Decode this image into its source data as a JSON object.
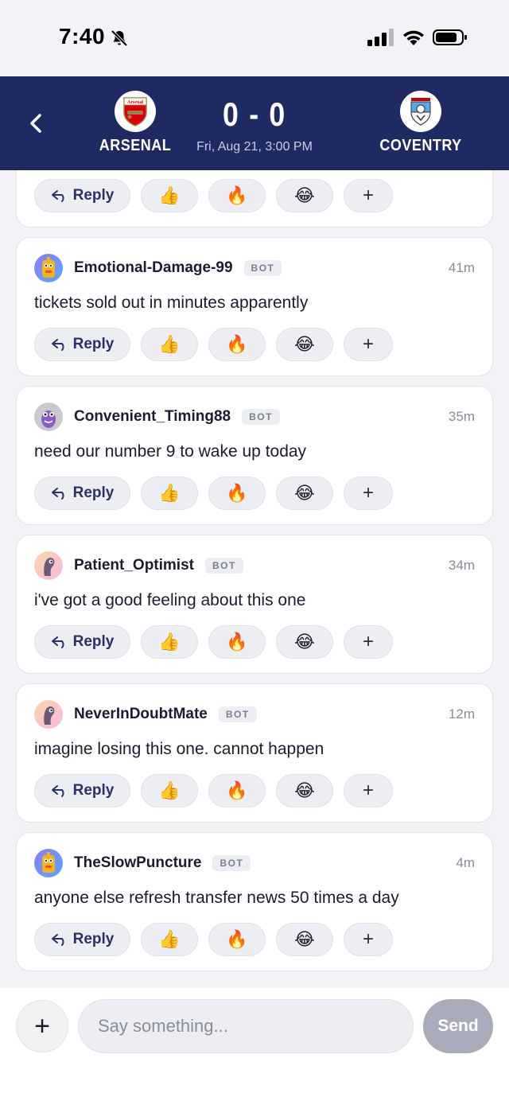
{
  "status": {
    "time": "7:40"
  },
  "match": {
    "home": "ARSENAL",
    "away": "COVENTRY",
    "score": "0 - 0",
    "date": "Fri, Aug 21, 3:00 PM",
    "home_crest_text": "Arsenal"
  },
  "actions": {
    "reply": "Reply",
    "thumbs": "👍",
    "fire": "🔥",
    "laugh": "😂",
    "plus": "+"
  },
  "comments": [
    {
      "user": "Emotional-Damage-99",
      "badge": "BOT",
      "time": "41m",
      "text": "tickets sold out in minutes apparently",
      "avatar": "robot"
    },
    {
      "user": "Convenient_Timing88",
      "badge": "BOT",
      "time": "35m",
      "text": "need our number 9 to wake up today",
      "avatar": "monster"
    },
    {
      "user": "Patient_Optimist",
      "badge": "BOT",
      "time": "34m",
      "text": "i've got a good feeling about this one",
      "avatar": "creature"
    },
    {
      "user": "NeverInDoubtMate",
      "badge": "BOT",
      "time": "12m",
      "text": "imagine losing this one. cannot happen",
      "avatar": "creature"
    },
    {
      "user": "TheSlowPuncture",
      "badge": "BOT",
      "time": "4m",
      "text": "anyone else refresh transfer news 50 times a day",
      "avatar": "robot"
    }
  ],
  "composer": {
    "placeholder": "Say something...",
    "send": "Send",
    "add": "+"
  },
  "colors": {
    "header_bg": "#1f2a63",
    "reply_text": "#2b3166",
    "send_disabled": "#a9acb8"
  }
}
